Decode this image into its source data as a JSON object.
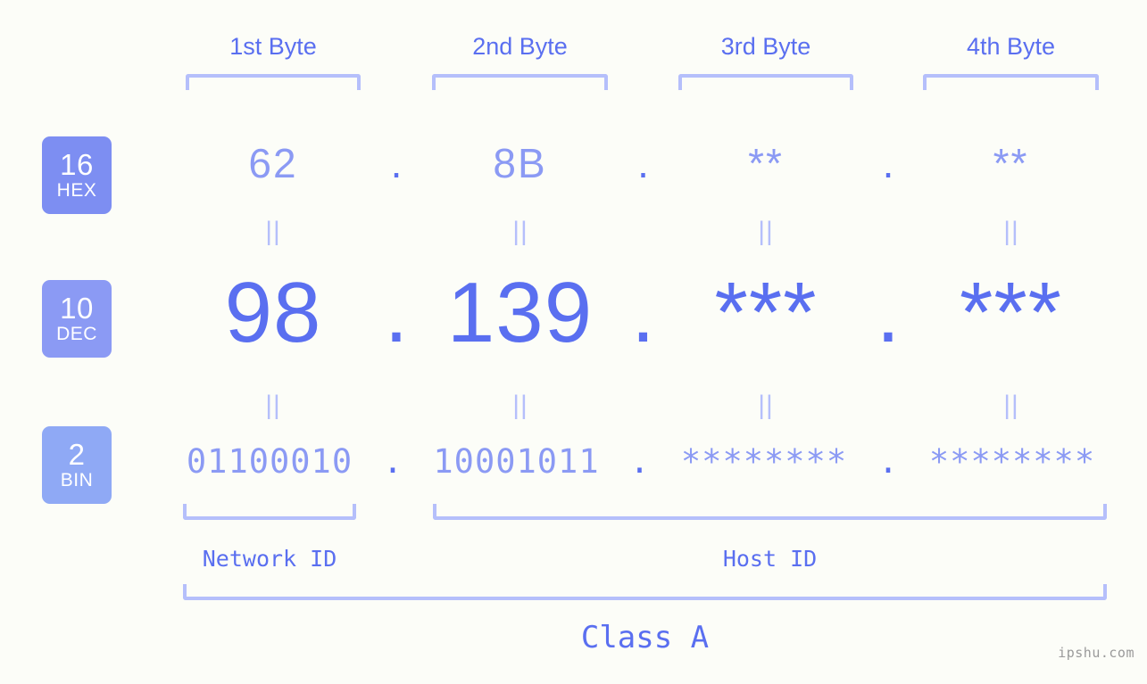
{
  "site": {
    "watermark": "ipshu.com"
  },
  "headers": [
    {
      "label": "1st Byte"
    },
    {
      "label": "2nd Byte"
    },
    {
      "label": "3rd Byte"
    },
    {
      "label": "4th Byte"
    }
  ],
  "bases": [
    {
      "radix": "16",
      "name": "HEX",
      "color": "#7d8ef2"
    },
    {
      "radix": "10",
      "name": "DEC",
      "color": "#8b9af4"
    },
    {
      "radix": "2",
      "name": "BIN",
      "color": "#8fa9f5"
    }
  ],
  "rows": {
    "hex": {
      "octets": [
        "62",
        "8B",
        "**",
        "**"
      ],
      "separator": "."
    },
    "dec": {
      "octets": [
        "98",
        "139",
        "***",
        "***"
      ],
      "separator": "."
    },
    "bin": {
      "octets": [
        "01100010",
        "10001011",
        "********",
        "********"
      ],
      "separator": "."
    }
  },
  "equals": {
    "mark": "||"
  },
  "segments": {
    "network": {
      "label": "Network ID"
    },
    "host": {
      "label": "Host ID"
    },
    "class": {
      "label": "Class A"
    }
  },
  "colors": {
    "background": "#fcfdf8",
    "accent": "#5a6ff0",
    "accent_mid": "#8b9af4",
    "accent_light": "#b5bffb",
    "watermark": "#9a9a9a"
  }
}
